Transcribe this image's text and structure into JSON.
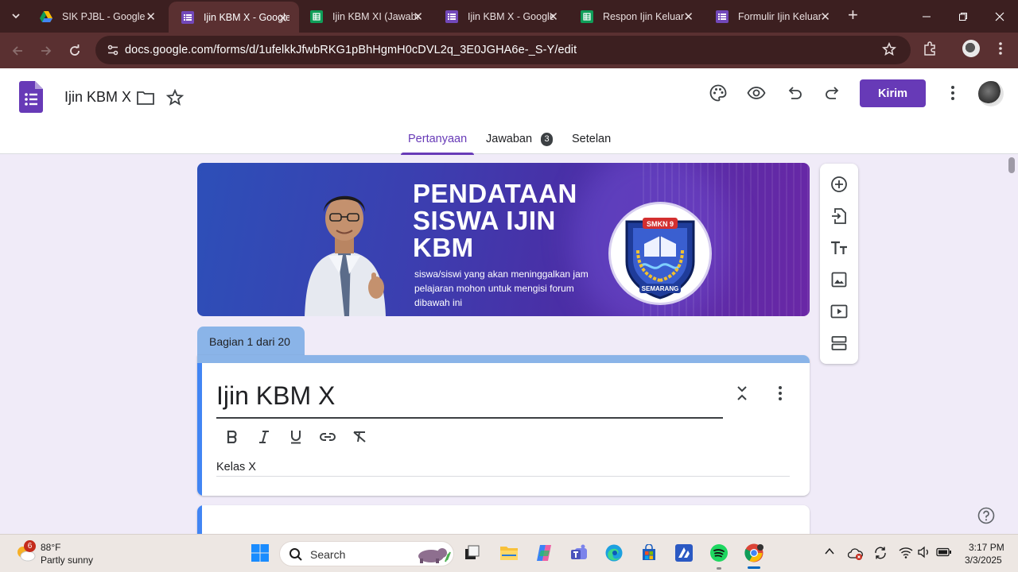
{
  "browser": {
    "tabs": [
      {
        "title": "SIK PJBL - Google Drive",
        "icon": "google-drive-icon"
      },
      {
        "title": "Ijin KBM X - Google Forms",
        "icon": "google-forms-icon"
      },
      {
        "title": "Ijin KBM XI (Jawaban)",
        "icon": "google-sheets-icon"
      },
      {
        "title": "Ijin KBM X - Google Forms",
        "icon": "google-forms-icon"
      },
      {
        "title": "Respon Ijin Keluar",
        "icon": "google-sheets-icon"
      },
      {
        "title": "Formulir Ijin Keluar",
        "icon": "google-forms-icon"
      }
    ],
    "url": "docs.google.com/forms/d/1ufelkkJfwbRKG1pBhHgmH0cDVL2q_3E0JGHA6e-_S-Y/edit"
  },
  "forms": {
    "doc_title": "Ijin KBM X",
    "send_label": "Kirim",
    "tabs": {
      "questions": "Pertanyaan",
      "responses": "Jawaban",
      "responses_count": "3",
      "settings": "Setelan"
    },
    "banner": {
      "title": "PENDATAAN SISWA IJIN KBM",
      "subtitle": "siswa/siswi yang akan meninggalkan jam pelajaran mohon untuk mengisi forum dibawah ini",
      "logo_top_text": "SMKN 9",
      "logo_bottom_text": "SEMARANG"
    },
    "section_label": "Bagian 1 dari 20",
    "form_title": "Ijin KBM X",
    "form_description": "Kelas X"
  },
  "taskbar": {
    "weather_badge": "6",
    "temperature": "88°F",
    "condition": "Partly sunny",
    "search_label": "Search",
    "time": "3:17 PM",
    "date": "3/3/2025"
  },
  "colors": {
    "forms_accent": "#673ab7",
    "browser_frame": "#3c1f20",
    "browser_toolbar": "#5a3031",
    "section_blue": "#8ab4e8"
  }
}
